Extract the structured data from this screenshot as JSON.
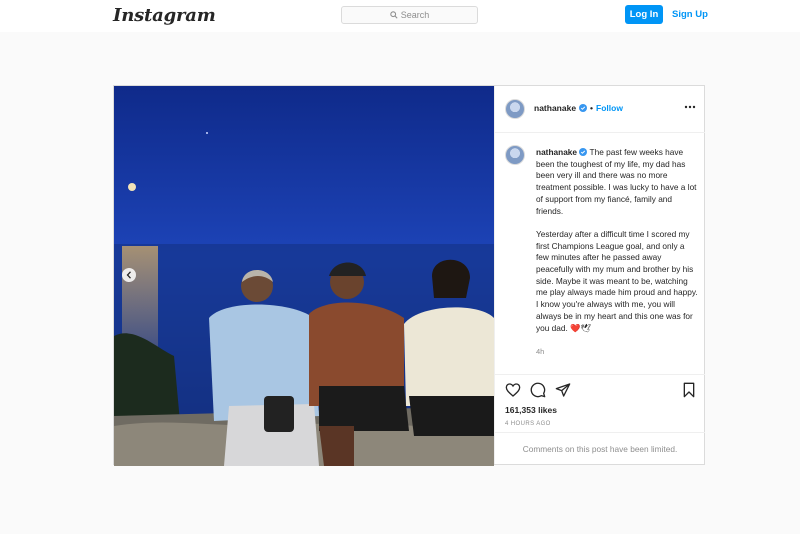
{
  "topbar": {
    "logo": "Instagram",
    "search_placeholder": "Search",
    "login_label": "Log In",
    "signup_label": "Sign Up"
  },
  "post": {
    "username": "nathanake",
    "follow_label": "Follow",
    "separator": "•",
    "caption_p1": "The past few weeks have been the toughest of my life, my dad has been very ill and there was no more treatment possible. I was lucky to have a lot of support from my fiancé, family and friends.",
    "caption_p2": "Yesterday after a difficult time I scored my first Champions League goal, and only a few minutes after he passed away peacefully with my mum and brother by his side. Maybe it was meant to be, watching me play always made him proud and happy. I know you're always with me, you will always be in my heart and this one was for you dad. ❤️🕊",
    "time_ago": "4h",
    "likes": "161,353 likes",
    "posted": "4 HOURS AGO",
    "comments_notice": "Comments on this post have been limited."
  },
  "colors": {
    "accent": "#0095f6",
    "text": "#262626",
    "muted": "#8e8e8e",
    "border": "#dbdbdb",
    "page_bg": "#fafafa"
  },
  "icons": {
    "search": "search-icon",
    "verified": "verified-badge-icon",
    "more": "more-options-icon",
    "like": "heart-icon",
    "comment": "comment-icon",
    "share": "share-icon",
    "save": "bookmark-icon",
    "prev": "chevron-left-icon"
  }
}
